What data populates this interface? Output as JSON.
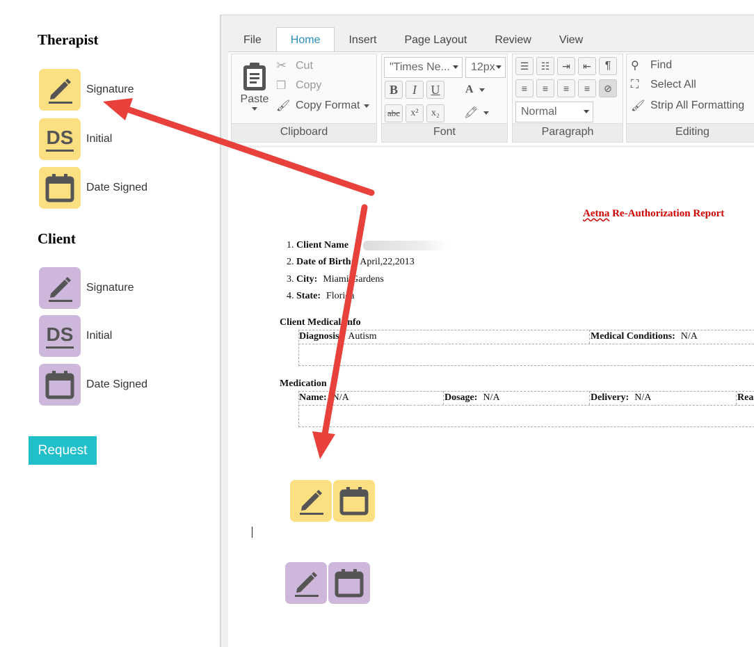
{
  "therapist": {
    "title": "Therapist",
    "fields": [
      {
        "label": "Signature",
        "icon": "signature-pen-icon"
      },
      {
        "label": "Initial",
        "icon": "initials-ds-icon"
      },
      {
        "label": "Date Signed",
        "icon": "calendar-icon"
      }
    ],
    "color": "#fbdf80"
  },
  "client": {
    "title": "Client",
    "fields": [
      {
        "label": "Signature",
        "icon": "signature-pen-icon"
      },
      {
        "label": "Initial",
        "icon": "initials-ds-icon"
      },
      {
        "label": "Date Signed",
        "icon": "calendar-icon"
      }
    ],
    "color": "#cdb8dc"
  },
  "request_button": "Request",
  "accent_color": "#21bfc9",
  "menu_tabs": [
    "File",
    "Home",
    "Insert",
    "Page Layout",
    "Review",
    "View"
  ],
  "active_tab": "Home",
  "ribbon": {
    "clipboard": {
      "name": "Clipboard",
      "paste": "Paste",
      "cut": "Cut",
      "copy": "Copy",
      "copy_format": "Copy Format"
    },
    "font": {
      "name": "Font",
      "family": "\"Times Ne...",
      "size": "12px",
      "bold": "B",
      "italic": "I",
      "underline": "U",
      "strike": "abc",
      "superscript": "x²",
      "subscript": "x₂",
      "font_color": "A"
    },
    "paragraph": {
      "name": "Paragraph",
      "style": "Normal"
    },
    "editing": {
      "name": "Editing",
      "find": "Find",
      "select_all": "Select All",
      "strip_formatting": "Strip All Formatting"
    }
  },
  "document": {
    "report_title_part1": "Aetna",
    "report_title_part2": "Re-Authorization Report",
    "info": [
      {
        "num": "1.",
        "label": "Client Name",
        "value": ""
      },
      {
        "num": "2.",
        "label": "Date of Birth:",
        "value": "April,22,2013"
      },
      {
        "num": "3.",
        "label": "City:",
        "value": "Miami Gardens"
      },
      {
        "num": "4.",
        "label": "State:",
        "value": "Florida"
      }
    ],
    "medical_section": "Client Medical Info",
    "diagnosis_label": "Diagnosis:",
    "diagnosis_value": "Autism",
    "conditions_label": "Medical Conditions:",
    "conditions_value": "N/A",
    "medication_section": "Medication",
    "med_name_label": "Name:",
    "med_name_value": "N/A",
    "dosage_label": "Dosage:",
    "dosage_value": "N/A",
    "delivery_label": "Delivery:",
    "delivery_value": "N/A",
    "reason_label": "Rea"
  },
  "annotation_arrow_color": "#e8413b"
}
